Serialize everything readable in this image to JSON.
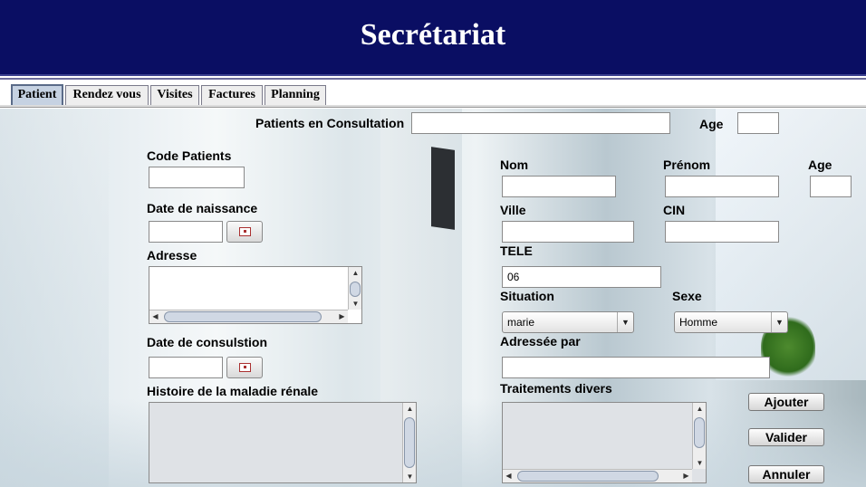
{
  "header": {
    "title": "Secrétariat"
  },
  "tabs": [
    {
      "label": "Patient",
      "active": true
    },
    {
      "label": "Rendez vous",
      "active": false
    },
    {
      "label": "Visites",
      "active": false
    },
    {
      "label": "Factures",
      "active": false
    },
    {
      "label": "Planning",
      "active": false
    }
  ],
  "form": {
    "consultation_label": "Patients en Consultation",
    "consultation_value": "",
    "age_top_label": "Age",
    "age_top_value": "",
    "code_label": "Code Patients",
    "code_value": "",
    "dob_label": "Date de naissance",
    "dob_value": "",
    "adresse_label": "Adresse",
    "adresse_value": "",
    "consult_date_label": "Date de consulstion",
    "consult_date_value": "",
    "histoire_label": "Histoire de la maladie rénale",
    "histoire_value": "",
    "nom_label": "Nom",
    "nom_value": "",
    "prenom_label": "Prénom",
    "prenom_value": "",
    "age_label": "Age",
    "age_value": "",
    "ville_label": "Ville",
    "ville_value": "",
    "cin_label": "CIN",
    "cin_value": "",
    "tele_label": "TELE",
    "tele_value": "06",
    "situation_label": "Situation",
    "situation_value": "marie",
    "sexe_label": "Sexe",
    "sexe_value": "Homme",
    "adressee_label": "Adressée par",
    "adressee_value": "",
    "traitements_label": "Traitements divers",
    "traitements_value": ""
  },
  "buttons": {
    "ajouter": "Ajouter",
    "valider": "Valider",
    "annuler": "Annuler"
  },
  "colors": {
    "header_bg": "#0a0e63",
    "header_text": "#ffffff",
    "active_tab": "#c6d2e2"
  }
}
